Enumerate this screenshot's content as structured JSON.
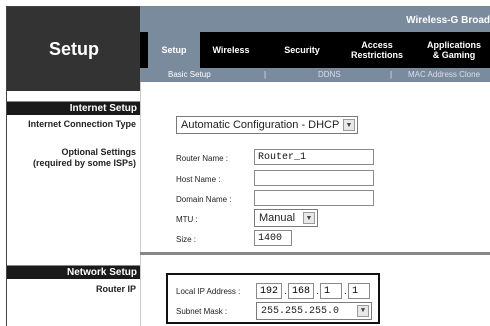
{
  "header": {
    "setup_title": "Setup",
    "brand": "Wireless-G Broad"
  },
  "tabs": [
    {
      "label": "Setup"
    },
    {
      "label": "Wireless"
    },
    {
      "label": "Security"
    },
    {
      "label": "Access\nRestrictions"
    },
    {
      "label": "Applications\n& Gaming"
    }
  ],
  "subtabs": {
    "basic_setup": "Basic Setup",
    "ddns": "DDNS",
    "mac_clone": "MAC Address Clone",
    "sep": "|"
  },
  "left": {
    "internet_setup": "Internet Setup",
    "connection_type": "Internet Connection Type",
    "optional_settings_1": "Optional Settings",
    "optional_settings_2": "(required by some ISPs)",
    "network_setup": "Network Setup",
    "router_ip": "Router IP"
  },
  "connection": {
    "selected": "Automatic Configuration - DHCP"
  },
  "optional": {
    "router_name_label": "Router Name :",
    "router_name_value": "Router_1",
    "host_name_label": "Host Name :",
    "host_name_value": "",
    "domain_name_label": "Domain Name :",
    "domain_name_value": "",
    "mtu_label": "MTU :",
    "mtu_selected": "Manual",
    "size_label": "Size :",
    "size_value": "1400"
  },
  "router_ip": {
    "local_ip_label": "Local IP Address :",
    "ip": [
      "192",
      "168",
      "1",
      "1"
    ],
    "dot": ".",
    "subnet_label": "Subnet Mask :",
    "subnet_selected": "255.255.255.0"
  },
  "icons": {
    "dropdown": "chevron-down-icon"
  }
}
